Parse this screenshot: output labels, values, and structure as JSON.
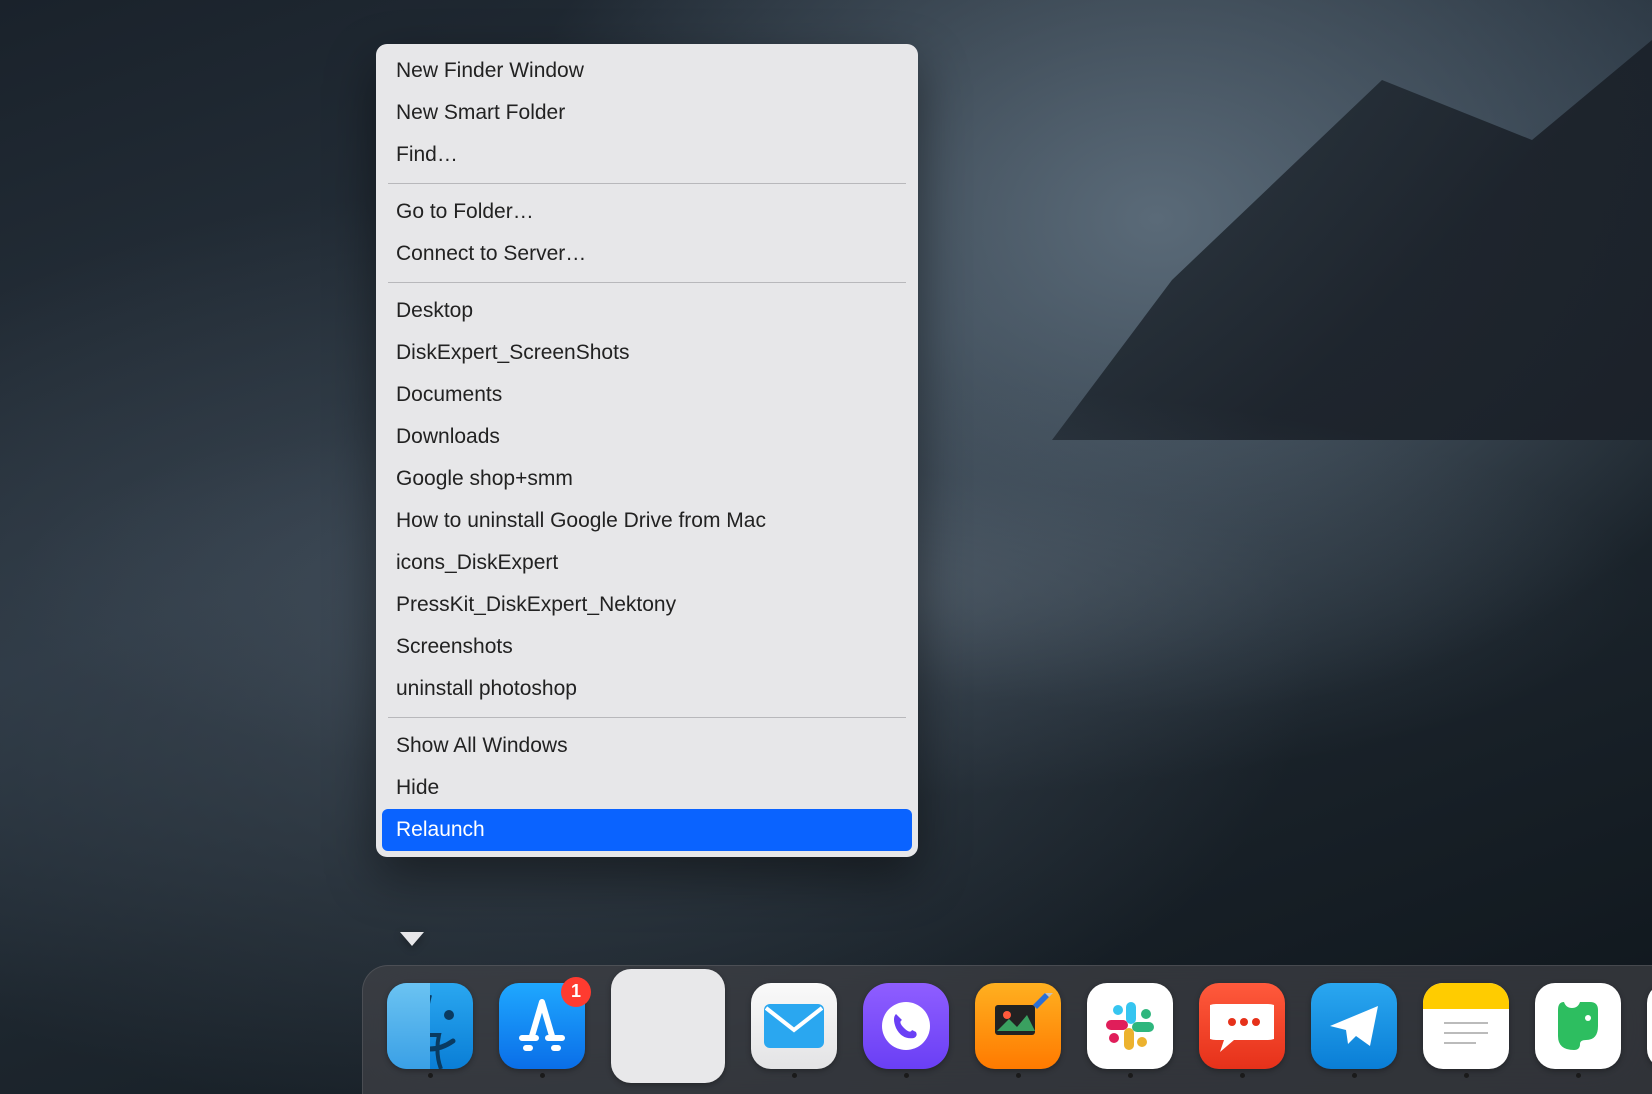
{
  "menu": {
    "groups": [
      {
        "items": [
          {
            "label": "New Finder Window",
            "name": "menu-new-finder-window"
          },
          {
            "label": "New Smart Folder",
            "name": "menu-new-smart-folder"
          },
          {
            "label": "Find…",
            "name": "menu-find"
          }
        ]
      },
      {
        "items": [
          {
            "label": "Go to Folder…",
            "name": "menu-go-to-folder"
          },
          {
            "label": "Connect to Server…",
            "name": "menu-connect-to-server"
          }
        ]
      },
      {
        "items": [
          {
            "label": "Desktop",
            "name": "menu-desktop"
          },
          {
            "label": "DiskExpert_ScreenShots",
            "name": "menu-diskexpert-screenshots"
          },
          {
            "label": "Documents",
            "name": "menu-documents"
          },
          {
            "label": "Downloads",
            "name": "menu-downloads"
          },
          {
            "label": "Google shop+smm",
            "name": "menu-google-shop-smm"
          },
          {
            "label": "How to uninstall Google Drive from Mac",
            "name": "menu-how-to-uninstall-google-drive"
          },
          {
            "label": "icons_DiskExpert",
            "name": "menu-icons-diskexpert"
          },
          {
            "label": "PressKit_DiskExpert_Nektony",
            "name": "menu-presskit-diskexpert"
          },
          {
            "label": "Screenshots",
            "name": "menu-screenshots"
          },
          {
            "label": "uninstall photoshop",
            "name": "menu-uninstall-photoshop"
          }
        ]
      },
      {
        "items": [
          {
            "label": "Show All Windows",
            "name": "menu-show-all-windows"
          },
          {
            "label": "Hide",
            "name": "menu-hide"
          },
          {
            "label": "Relaunch",
            "name": "menu-relaunch",
            "highlight": true
          }
        ]
      }
    ]
  },
  "dock": {
    "apps": [
      {
        "name": "finder-icon",
        "cls": "finder",
        "running": true
      },
      {
        "name": "appstore-icon",
        "cls": "appstore",
        "running": true,
        "badge": "1"
      },
      {
        "name": "launchpad-icon",
        "cls": "launchpad",
        "running": false
      },
      {
        "name": "mail-icon",
        "cls": "mail",
        "running": true
      },
      {
        "name": "viber-icon",
        "cls": "viber",
        "running": true
      },
      {
        "name": "pixelmator-icon",
        "cls": "pixelmator",
        "running": true
      },
      {
        "name": "slack-icon",
        "cls": "slack",
        "running": true
      },
      {
        "name": "chat-icon",
        "cls": "chat",
        "running": true
      },
      {
        "name": "telegram-icon",
        "cls": "telegram",
        "running": true
      },
      {
        "name": "notes-icon",
        "cls": "notes",
        "running": true
      },
      {
        "name": "evernote-icon",
        "cls": "evernote",
        "running": true
      },
      {
        "name": "chrome-icon",
        "cls": "chrome",
        "running": true
      },
      {
        "name": "pages-icon",
        "cls": "pages",
        "running": true
      }
    ]
  }
}
